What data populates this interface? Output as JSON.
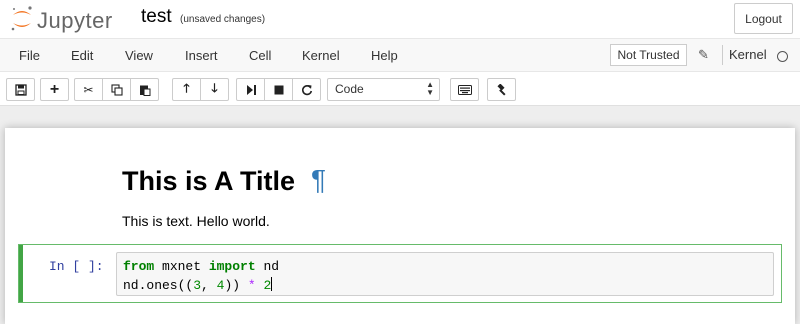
{
  "header": {
    "logo_text": "Jupyter",
    "notebook_title": "test",
    "save_status": "(unsaved changes)",
    "logout_label": "Logout"
  },
  "menubar": {
    "items": [
      "File",
      "Edit",
      "View",
      "Insert",
      "Cell",
      "Kernel",
      "Help"
    ],
    "trusted_label": "Not Trusted",
    "kernel_label": "Kernel"
  },
  "toolbar": {
    "buttons": [
      "save-icon",
      "insert-cell-below-icon",
      "cut-icon",
      "copy-icon",
      "paste-icon",
      "move-up-icon",
      "move-down-icon",
      "run-icon",
      "interrupt-icon",
      "restart-icon",
      "keyboard-icon",
      "celltoolbar-icon"
    ],
    "cell_type": "Code"
  },
  "notebook": {
    "markdown_title": "This is A Title",
    "anchor": "¶",
    "markdown_text": "This is text. Hello world.",
    "code_cell": {
      "prompt": "In [ ]:",
      "line1": {
        "kw1": "from",
        "mod": " mxnet ",
        "kw2": "import",
        "name": " nd"
      },
      "line2": {
        "call": "nd.ones((",
        "n1": "3",
        "sep": ", ",
        "n2": "4",
        "close": ")) ",
        "op": "*",
        "sp": " ",
        "n3": "2"
      }
    }
  },
  "colors": {
    "accent": "#337ab7",
    "cell_selected": "#42a545",
    "prompt": "#303f9f"
  }
}
